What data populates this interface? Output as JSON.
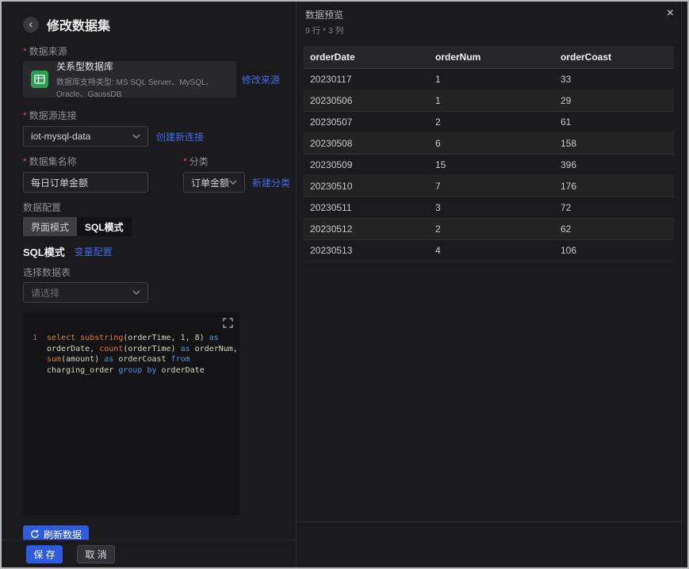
{
  "colors": {
    "accent": "#2e5bdf",
    "link": "#4468e8",
    "danger": "#e2474b",
    "green": "#2f9e55"
  },
  "left": {
    "back": "‹",
    "title": "修改数据集",
    "source": {
      "label": "数据来源",
      "card_title": "关系型数据库",
      "card_subtitle": "数据库支持类型: MS SQL Server、MySQL、Oracle、GaussDB",
      "modify_link": "修改来源"
    },
    "connection": {
      "label": "数据源连接",
      "value": "iot-mysql-data",
      "new_link": "创建新连接"
    },
    "dataset": {
      "name_label": "数据集名称",
      "name_value": "每日订单金额",
      "category_label": "分类",
      "category_value": "订单金额",
      "new_category_link": "新建分类"
    },
    "config": {
      "label": "数据配置",
      "tabs": [
        "界面模式",
        "SQL模式"
      ],
      "active_tab": "SQL模式"
    },
    "sql": {
      "title": "SQL模式",
      "variable_link": "变量配置",
      "table_label": "选择数据表",
      "table_placeholder": "请选择",
      "line_number": "1",
      "tokens": [
        {
          "t": "select ",
          "c": "kw"
        },
        {
          "t": "substring",
          "c": "fn"
        },
        {
          "t": "(orderTime, 1, 8) ",
          "c": "pl"
        },
        {
          "t": "as",
          "c": "op"
        },
        {
          "t": "\norderDate, ",
          "c": "pl"
        },
        {
          "t": "count",
          "c": "fn"
        },
        {
          "t": "(orderTime) ",
          "c": "pl"
        },
        {
          "t": "as",
          "c": "op"
        },
        {
          "t": " orderNum,\n",
          "c": "pl"
        },
        {
          "t": "sum",
          "c": "fn"
        },
        {
          "t": "(amount) ",
          "c": "pl"
        },
        {
          "t": "as",
          "c": "op"
        },
        {
          "t": " orderCoast ",
          "c": "pl"
        },
        {
          "t": "from",
          "c": "op"
        },
        {
          "t": "\ncharging_order ",
          "c": "pl"
        },
        {
          "t": "group by",
          "c": "op"
        },
        {
          "t": " orderDate",
          "c": "pl"
        }
      ]
    },
    "refresh_button": "刷新数据",
    "save_button": "保 存",
    "cancel_button": "取 消"
  },
  "preview": {
    "title": "数据预览",
    "dims": "9 行 * 3 列",
    "close": "×",
    "columns": [
      "orderDate",
      "orderNum",
      "orderCoast"
    ],
    "rows": [
      [
        "20230117",
        "1",
        "33"
      ],
      [
        "20230506",
        "1",
        "29"
      ],
      [
        "20230507",
        "2",
        "61"
      ],
      [
        "20230508",
        "6",
        "158"
      ],
      [
        "20230509",
        "15",
        "396"
      ],
      [
        "20230510",
        "7",
        "176"
      ],
      [
        "20230511",
        "3",
        "72"
      ],
      [
        "20230512",
        "2",
        "62"
      ],
      [
        "20230513",
        "4",
        "106"
      ]
    ]
  }
}
